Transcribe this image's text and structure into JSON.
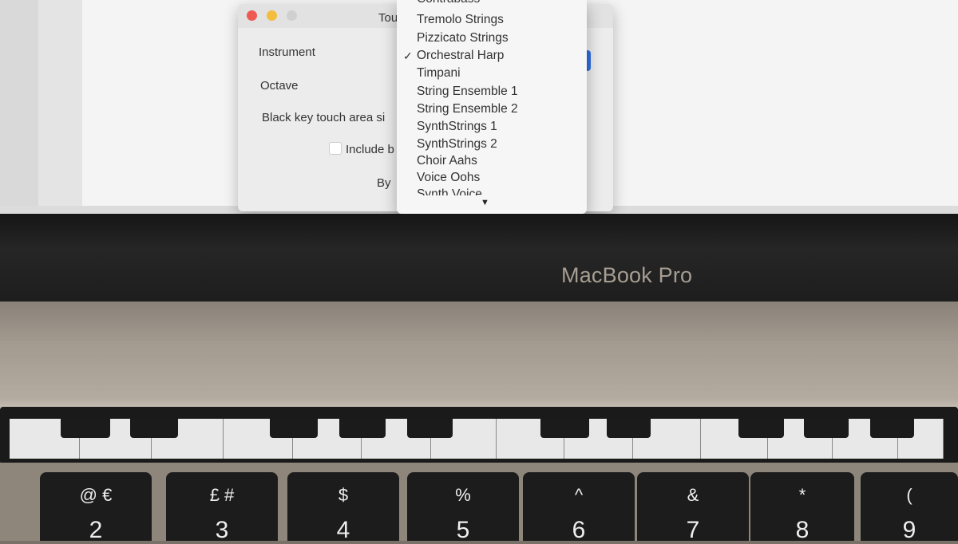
{
  "dialog": {
    "title": "Tou",
    "labels": {
      "instrument": "Instrument",
      "octave": "Octave",
      "black_key": "Black key touch area si",
      "include": "Include b",
      "by": "By"
    }
  },
  "menu": {
    "items": [
      "Contrabass",
      "Tremolo Strings",
      "Pizzicato Strings",
      "Orchestral Harp",
      "Timpani",
      "String Ensemble 1",
      "String Ensemble 2",
      "SynthStrings 1",
      "SynthStrings 2",
      "Choir Aahs",
      "Voice Oohs",
      "Synth Voice"
    ],
    "selected": "Orchestral Harp",
    "check": "✓",
    "scroll_arrow": "▼"
  },
  "laptop": {
    "brand": "MacBook Pro"
  },
  "keyboard": [
    {
      "sym": "@ €",
      "num": "2"
    },
    {
      "sym": "£ #",
      "num": "3"
    },
    {
      "sym": "$",
      "num": "4"
    },
    {
      "sym": "%",
      "num": "5"
    },
    {
      "sym": "^",
      "num": "6"
    },
    {
      "sym": "&",
      "num": "7"
    },
    {
      "sym": "*",
      "num": "8"
    },
    {
      "sym": "(",
      "num": "9"
    }
  ],
  "colors": {
    "close": "#ee5a52",
    "minimize": "#f4bd3f",
    "zoom": "#d0d0d0",
    "accent": "#2f6fe0"
  }
}
